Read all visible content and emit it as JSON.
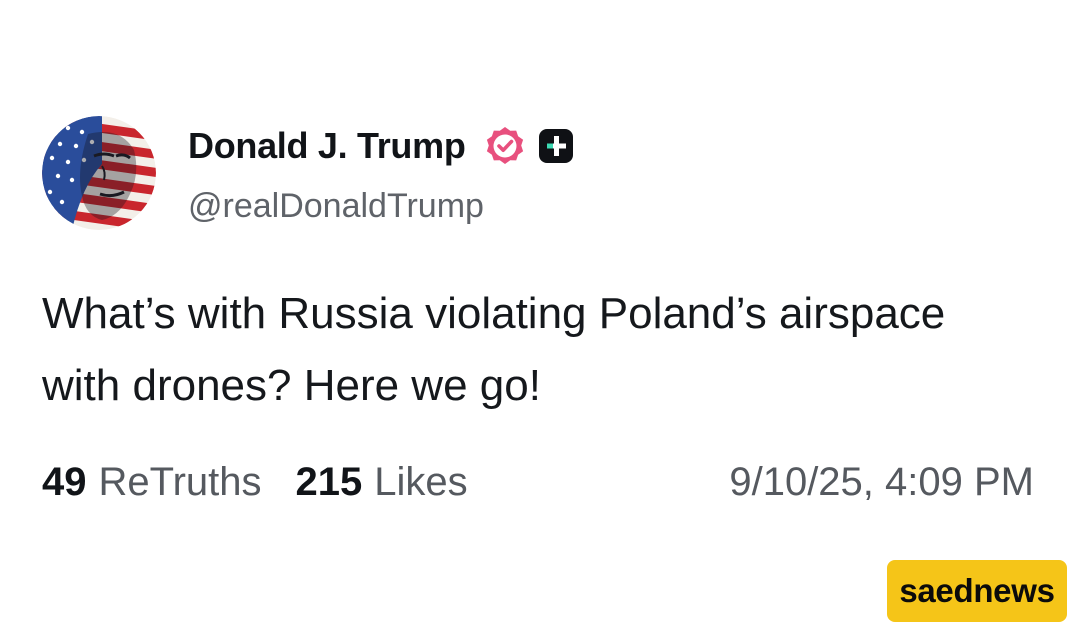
{
  "post": {
    "author": {
      "name": "Donald J. Trump",
      "handle": "@realDonaldTrump",
      "avatar_icon": "flag-portrait-avatar",
      "verified_icon": "verified-badge-icon",
      "plus_icon": "plus-badge-icon"
    },
    "text": "What’s with Russia violating Poland’s airspace with drones? Here we go!",
    "stats": {
      "retruths_count": "49",
      "retruths_label": "ReTruths",
      "likes_count": "215",
      "likes_label": "Likes"
    },
    "timestamp": "9/10/25, 4:09 PM"
  },
  "watermark": {
    "text": "saednews"
  },
  "colors": {
    "background": "#ffffff",
    "text_primary": "#111418",
    "text_secondary": "#55595f",
    "verified_badge": "#e8507e",
    "plus_badge": "#0f1115",
    "watermark_bg": "#f5c518"
  }
}
